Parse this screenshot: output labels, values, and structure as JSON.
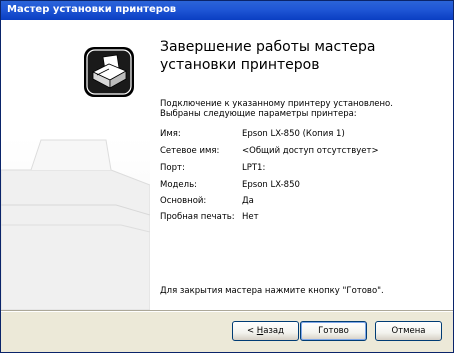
{
  "window": {
    "title": "Мастер установки принтеров"
  },
  "heading": "Завершение работы мастера установки принтеров",
  "intro": [
    "Подключение к указанному принтеру установлено.",
    "Выбраны следующие параметры принтера:"
  ],
  "settings": [
    {
      "label": "Имя:",
      "value": "Epson LX-850 (Копия 1)"
    },
    {
      "label": "Сетевое имя:",
      "value": "<Общий доступ отсутствует>"
    },
    {
      "label": "Порт:",
      "value": "LPT1:"
    },
    {
      "label": "Модель:",
      "value": "Epson LX-850"
    },
    {
      "label": "Основной:",
      "value": "Да"
    },
    {
      "label": "Пробная печать:",
      "value": "Нет"
    }
  ],
  "footer": "Для закрытия мастера нажмите кнопку \"Готово\".",
  "buttons": {
    "back_prefix": "< ",
    "back_key": "Н",
    "back_rest": "азад",
    "finish": "Готово",
    "cancel": "Отмена"
  },
  "icons": {
    "wizard": "printer-icon"
  }
}
